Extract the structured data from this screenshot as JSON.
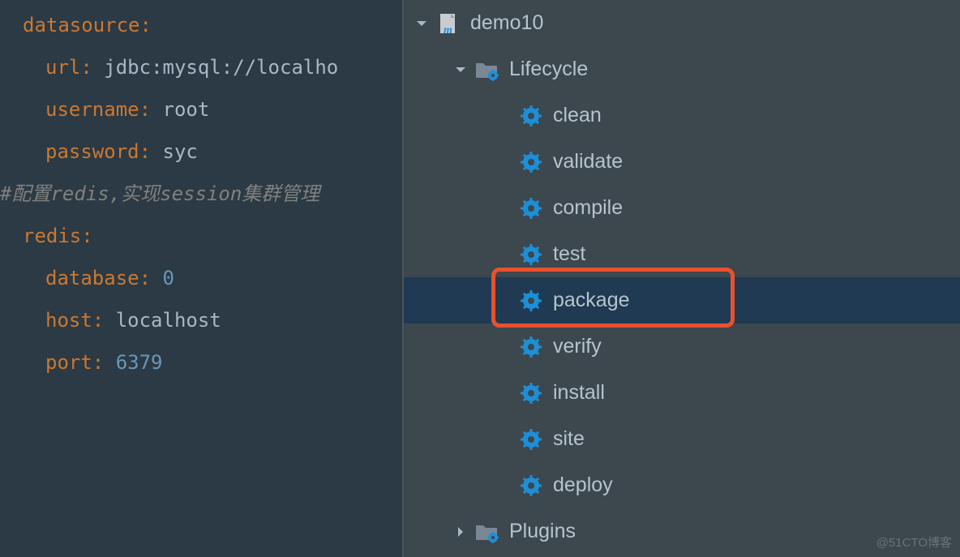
{
  "editor": {
    "lines": [
      {
        "indent": 1,
        "key": "datasource",
        "colon": ":"
      },
      {
        "indent": 2,
        "key": "url",
        "colon": ": ",
        "val": "jdbc:mysql://localho"
      },
      {
        "indent": 2,
        "key": "username",
        "colon": ": ",
        "val": "root"
      },
      {
        "indent": 2,
        "key": "password",
        "colon": ": ",
        "val": "syc"
      },
      {
        "indent": 0,
        "comment": "#配置redis,实现session集群管理"
      },
      {
        "indent": 1,
        "key": "redis",
        "colon": ":"
      },
      {
        "indent": 2,
        "key": "database",
        "colon": ": ",
        "num": "0"
      },
      {
        "indent": 2,
        "key": "host",
        "colon": ": ",
        "val": "localhost"
      },
      {
        "indent": 2,
        "key": "port",
        "colon": ": ",
        "num": "6379"
      }
    ]
  },
  "tree": {
    "root": {
      "label": "demo10"
    },
    "lifecycle": {
      "label": "Lifecycle"
    },
    "goals": [
      "clean",
      "validate",
      "compile",
      "test",
      "package",
      "verify",
      "install",
      "site",
      "deploy"
    ],
    "selected_index": 4,
    "plugins": {
      "label": "Plugins"
    }
  },
  "watermark": "@51CTO博客"
}
